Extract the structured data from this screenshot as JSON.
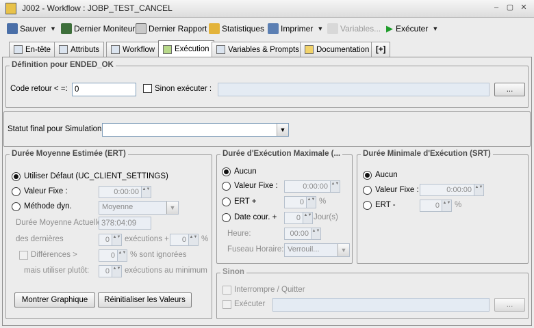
{
  "window": {
    "title": "J002 - Workflow : JOBP_TEST_CANCEL",
    "buttons": [
      "–",
      "▢",
      "✕"
    ]
  },
  "toolbar": {
    "save": "Sauver",
    "monitor": "Dernier Moniteur",
    "report": "Dernier Rapport",
    "stats": "Statistiques",
    "print": "Imprimer",
    "variables": "Variables...",
    "execute": "Exécuter",
    "dropdown_glyph": "▼"
  },
  "tabs": [
    {
      "label": "En-tête",
      "icon": "header-icon"
    },
    {
      "label": "Attributs",
      "icon": "attributes-icon"
    },
    {
      "label": "Workflow",
      "icon": "workflow-icon"
    },
    {
      "label": "Exécution",
      "icon": "execution-icon",
      "active": true
    },
    {
      "label": "Variables & Prompts",
      "icon": "variables-icon"
    },
    {
      "label": "Documentation",
      "icon": "documentation-icon"
    },
    {
      "label": "[+]",
      "icon": "add-tab-icon"
    }
  ],
  "definition": {
    "title": "Définition pour ENDED_OK",
    "code_label": "Code retour < =:",
    "code_value": "0",
    "else_label": "Sinon exécuter :",
    "else_value": "",
    "browse": "..."
  },
  "simulation": {
    "label": "Statut final pour Simulation:",
    "value": ""
  },
  "ert": {
    "title": "Durée Moyenne Estimée (ERT)",
    "default_label": "Utiliser Défaut (UC_CLIENT_SETTINGS)",
    "fixed_label": "Valeur Fixe :",
    "fixed_value": "0:00:00",
    "dyn_label": "Méthode dyn.",
    "dyn_value": "Moyenne",
    "current_label": "Durée Moyenne Actuelle",
    "current_value": "378:04:09",
    "last_label": "des dernières",
    "last_value": "0",
    "exec_plus": "exécutions +",
    "pct_value": "0",
    "pct": "%",
    "diff_label": "Différences >",
    "diff_value": "0",
    "ignored": "% sont ignorées",
    "instead_label": "mais utiliser plutôt:",
    "instead_value": "0",
    "min_exec": "exécutions au minimum",
    "show_chart": "Montrer Graphique",
    "reset": "Réinitialiser les Valeurs"
  },
  "mrt": {
    "title": "Durée d'Exécution Maximale (...",
    "none": "Aucun",
    "fixed_label": "Valeur Fixe :",
    "fixed_value": "0:00:00",
    "ert_plus": "ERT +",
    "ert_value": "0",
    "pct": "%",
    "date_label": "Date cour. +",
    "date_value": "0",
    "days": "Jour(s)",
    "hour_label": "Heure:",
    "hour_value": "00:00",
    "tz_label": "Fuseau Horaire:",
    "tz_value": "Verrouil..."
  },
  "srt": {
    "title": "Durée Minimale d'Exécution (SRT)",
    "none": "Aucun",
    "fixed_label": "Valeur Fixe :",
    "fixed_value": "0:00:00",
    "ert_minus": "ERT -",
    "ert_value": "0",
    "pct": "%"
  },
  "else": {
    "title": "Sinon",
    "interrupt": "Interrompre / Quitter",
    "execute": "Exécuter",
    "browse": "..."
  },
  "spin_glyph": "▲▼"
}
